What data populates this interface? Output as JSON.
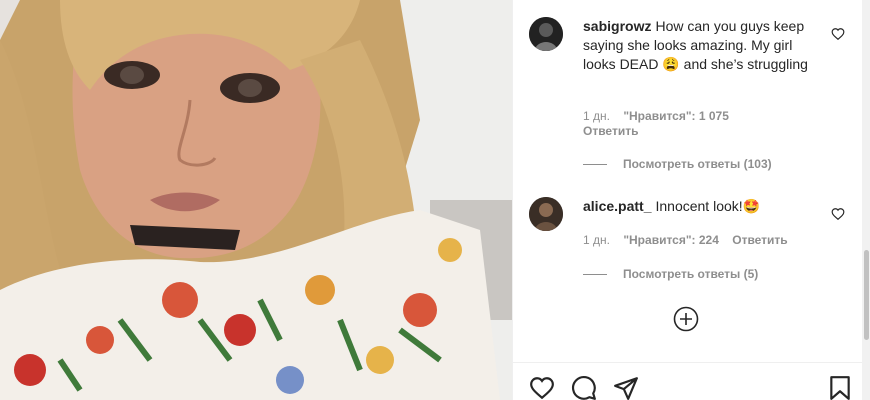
{
  "post": {
    "photo_icon": "photo-selfie"
  },
  "comments": [
    {
      "username": "sabigrowz",
      "text": "How can you guys keep saying she looks amazing. My girl looks DEAD 😩 and she’s struggling",
      "time": "1 дн.",
      "likes": "\"Нравится\": 1 075",
      "reply": "Ответить",
      "view_replies": "Посмотреть ответы (103)"
    },
    {
      "username": "alice.patt_",
      "text": "Innocent look!🤩",
      "time": "1 дн.",
      "likes": "\"Нравится\": 224",
      "reply": "Ответить",
      "view_replies": "Посмотреть ответы (5)"
    }
  ],
  "icons": {
    "like": "heart-icon",
    "comment": "comment-icon",
    "share": "share-icon",
    "save": "bookmark-icon",
    "load_more": "plus-circle-icon"
  }
}
